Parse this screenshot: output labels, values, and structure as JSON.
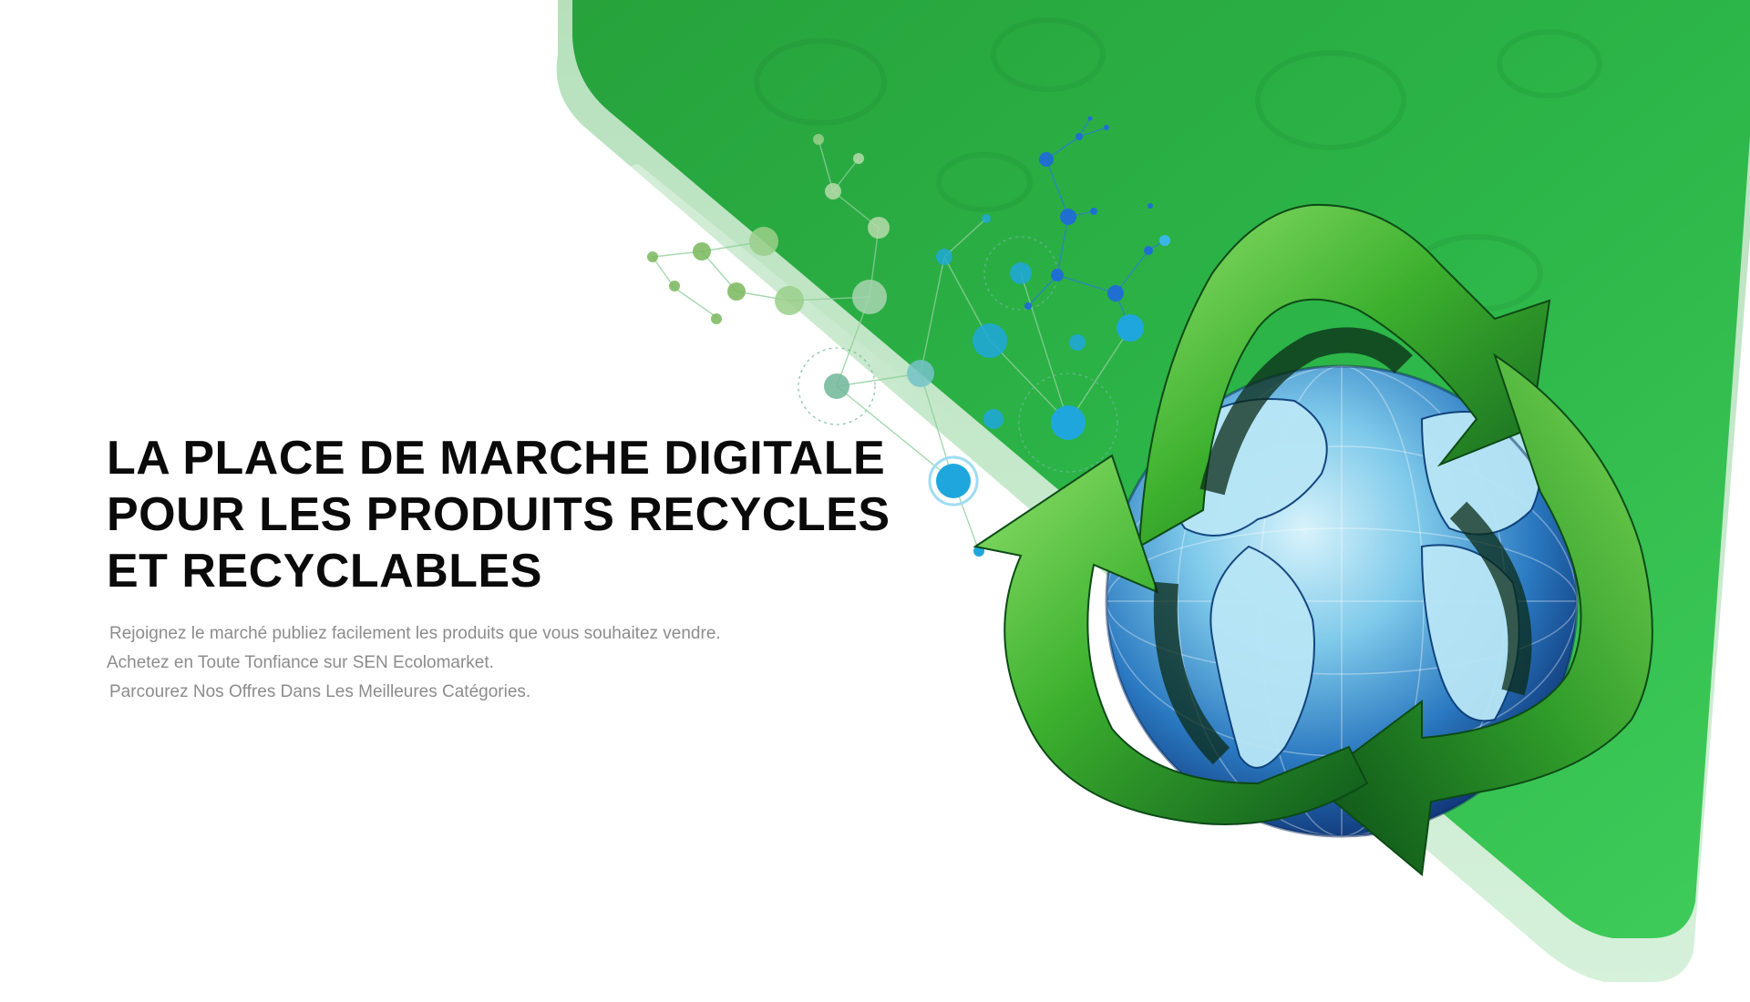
{
  "hero": {
    "title_lines": [
      "LA PLACE DE MARCHE DIGITALE",
      "POUR LES PRODUITS RECYCLES",
      "ET RECYCLABLES"
    ],
    "subtitle_lines": [
      "Rejoignez le marché publiez facilement les produits que vous souhaitez vendre.",
      "Achetez en Toute Tonfiance sur SEN Ecolomarket.",
      "Parcourez Nos Offres Dans Les Meilleures Catégories."
    ]
  },
  "illustration": {
    "icon": "recycle-globe-icon",
    "colors": {
      "green_panel": "#2fb84a",
      "green_dark": "#1a7a2a",
      "globe_blue": "#1f6fb5",
      "globe_light": "#8fd3ee",
      "network_blue": "#1ea2d8",
      "network_green": "#7cc24c"
    }
  }
}
